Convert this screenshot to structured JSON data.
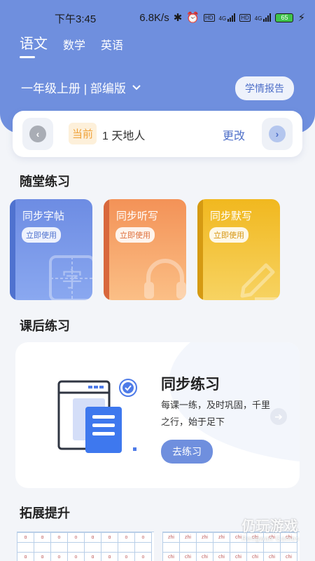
{
  "status_bar": {
    "time": "下午3:45",
    "speed": "6.8K/s",
    "net1": "4G",
    "net2": "4G",
    "hd1": "HD",
    "hd2": "HD",
    "battery": "65"
  },
  "subjects": [
    "语文",
    "数学",
    "英语"
  ],
  "active_subject": "语文",
  "grade": "一年级上册 | 部编版",
  "report_button": "学情报告",
  "lesson": {
    "current_tag": "当前",
    "name": "1 天地人",
    "change": "更改"
  },
  "section1_title": "随堂练习",
  "practice_cards": [
    {
      "title": "同步字帖",
      "action": "立即使用",
      "deco_char": "字"
    },
    {
      "title": "同步听写",
      "action": "立即使用"
    },
    {
      "title": "同步默写",
      "action": "立即使用"
    }
  ],
  "section2_title": "课后练习",
  "sync_card": {
    "title": "同步练习",
    "desc": "每课一练，及时巩固，千里之行，始于足下",
    "button": "去练习"
  },
  "section3_title": "拓展提升",
  "thumb_left": {
    "row1": [
      "ɑ",
      "ɑ",
      "o",
      "o",
      "ɑ",
      "ɑ",
      "o",
      "o"
    ],
    "row2": [
      "ɑ",
      "ɑ",
      "o",
      "o",
      "ɑ",
      "ɑ",
      "o",
      "o"
    ]
  },
  "thumb_right": {
    "row1": [
      "zhi",
      "zhi",
      "zhi",
      "zhi",
      "chi",
      "chi",
      "chi",
      "chi"
    ],
    "row2": [
      "chi",
      "chi",
      "chi",
      "chi",
      "chi",
      "chi",
      "chi",
      "chi"
    ]
  },
  "watermark": {
    "title": "仍玩游戏",
    "sub": "Rengwan Games"
  },
  "colors": {
    "primary": "#6f8fde",
    "orange": "#f39257",
    "yellow": "#f1b81f",
    "current": "#f0a33b"
  }
}
